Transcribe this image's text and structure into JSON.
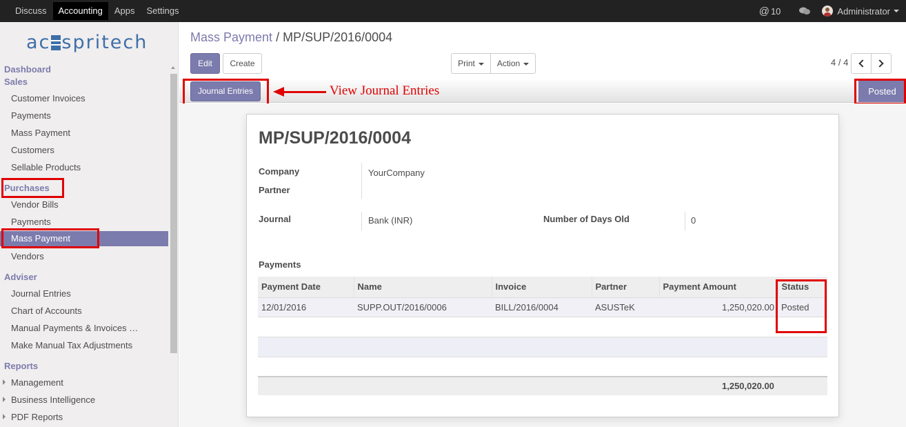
{
  "topbar": {
    "menu": [
      "Discuss",
      "Accounting",
      "Apps",
      "Settings"
    ],
    "active_menu": "Accounting",
    "messages_count": "10",
    "user": "Administrator"
  },
  "sidebar": {
    "logo": "acspritech",
    "sections": [
      {
        "title": "Dashboard",
        "items": []
      },
      {
        "title": "Sales",
        "items": [
          "Customer Invoices",
          "Payments",
          "Mass Payment",
          "Customers",
          "Sellable Products"
        ]
      },
      {
        "title": "Purchases",
        "items": [
          "Vendor Bills",
          "Payments",
          "Mass Payment",
          "Vendors"
        ]
      },
      {
        "title": "Adviser",
        "items": [
          "Journal Entries",
          "Chart of Accounts",
          "Manual Payments & Invoices …",
          "Make Manual Tax Adjustments"
        ]
      },
      {
        "title": "Reports",
        "items": [
          "Management",
          "Business Intelligence",
          "PDF Reports"
        ]
      }
    ],
    "active_item": "Mass Payment"
  },
  "breadcrumb": {
    "parent": "Mass Payment",
    "separator": "/",
    "current": "MP/SUP/2016/0004"
  },
  "buttons": {
    "edit": "Edit",
    "create": "Create",
    "print": "Print",
    "action": "Action",
    "journal_entries": "Journal Entries"
  },
  "pager": {
    "value": "4 / 4"
  },
  "status": "Posted",
  "annotation": "View Journal Entries",
  "record": {
    "title": "MP/SUP/2016/0004",
    "company_label": "Company",
    "company": "YourCompany",
    "partner_label": "Partner",
    "partner": "",
    "journal_label": "Journal",
    "journal": "Bank (INR)",
    "days_old_label": "Number of Days Old",
    "days_old": "0",
    "payments_label": "Payments"
  },
  "payments_table": {
    "columns": [
      "Payment Date",
      "Name",
      "Invoice",
      "Partner",
      "Payment Amount",
      "Status"
    ],
    "rows": [
      {
        "date": "12/01/2016",
        "name": "SUPP.OUT/2016/0006",
        "invoice": "BILL/2016/0004",
        "partner": "ASUSTeK",
        "amount": "1,250,020.00",
        "status": "Posted"
      }
    ],
    "total": "1,250,020.00"
  },
  "colors": {
    "accent": "#7c7bad",
    "annotation": "#e00000",
    "topbar": "#222222"
  }
}
